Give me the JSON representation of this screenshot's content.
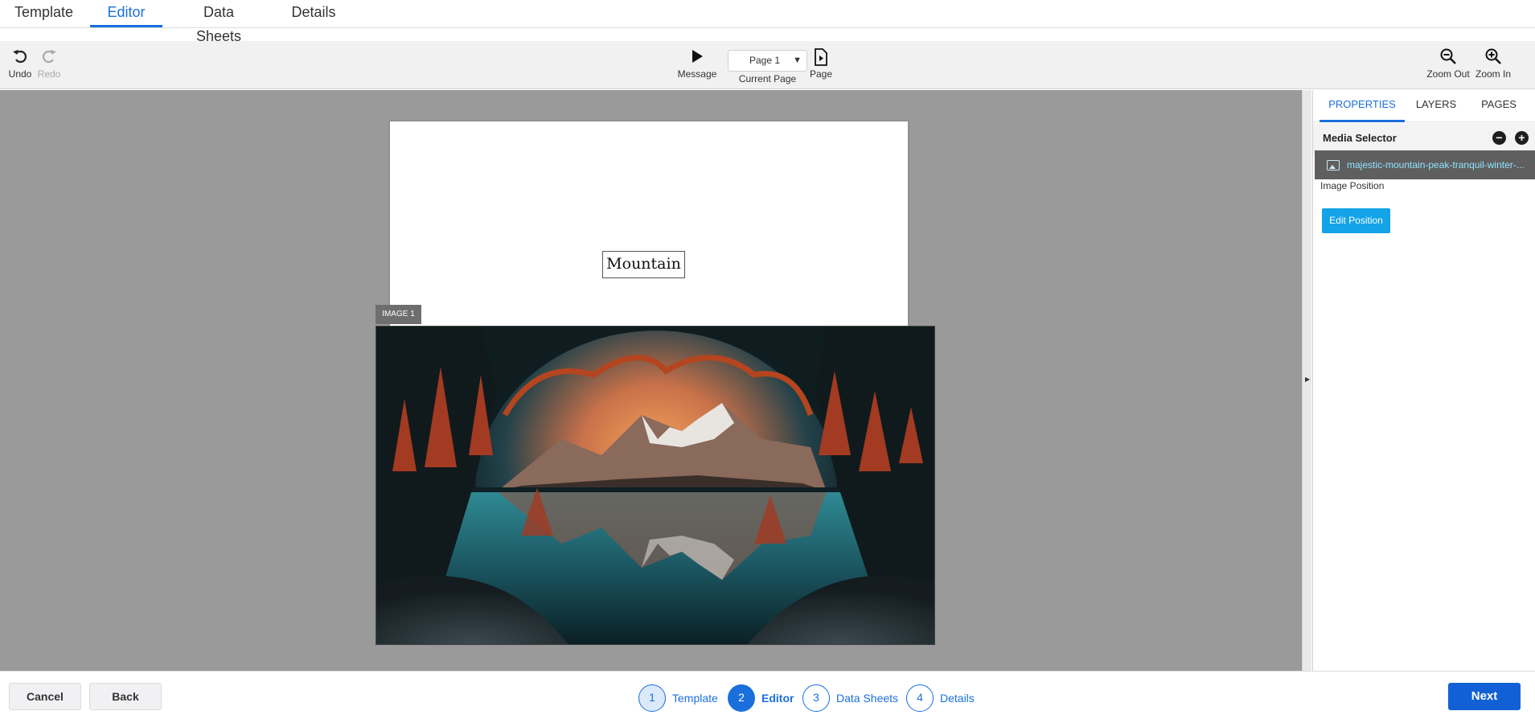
{
  "top_tabs": [
    {
      "label": "Template"
    },
    {
      "label": "Editor"
    },
    {
      "label": "Data Sheets"
    },
    {
      "label": "Details"
    }
  ],
  "toolbar": {
    "undo_label": "Undo",
    "redo_label": "Redo",
    "message_label": "Message",
    "page_select_value": "Page 1",
    "current_page_label": "Current Page",
    "page_label": "Page",
    "zoom_out_label": "Zoom Out",
    "zoom_in_label": "Zoom In"
  },
  "canvas": {
    "text_box": "Mountain",
    "image_tag": "IMAGE 1"
  },
  "panel": {
    "tabs": [
      {
        "label": "PROPERTIES"
      },
      {
        "label": "LAYERS"
      },
      {
        "label": "PAGES"
      }
    ],
    "media_selector_title": "Media Selector",
    "media_file": "majestic-mountain-peak-tranquil-winter-...",
    "image_position_label": "Image Position",
    "edit_position_label": "Edit Position"
  },
  "footer": {
    "cancel_label": "Cancel",
    "back_label": "Back",
    "next_label": "Next",
    "steps": [
      {
        "num": "1",
        "label": "Template"
      },
      {
        "num": "2",
        "label": "Editor"
      },
      {
        "num": "3",
        "label": "Data Sheets"
      },
      {
        "num": "4",
        "label": "Details"
      }
    ]
  },
  "colors": {
    "accent": "#1a6fdc",
    "edit_button": "#13a3e6",
    "canvas_bg": "#9a9a9a",
    "next_button": "#1260d6"
  },
  "icons": [
    "undo-icon",
    "redo-icon",
    "play-icon",
    "page-preview-icon",
    "zoom-out-icon",
    "zoom-in-icon",
    "image-file-icon",
    "minus-circle-icon",
    "plus-circle-icon",
    "collapse-arrow-icon"
  ]
}
